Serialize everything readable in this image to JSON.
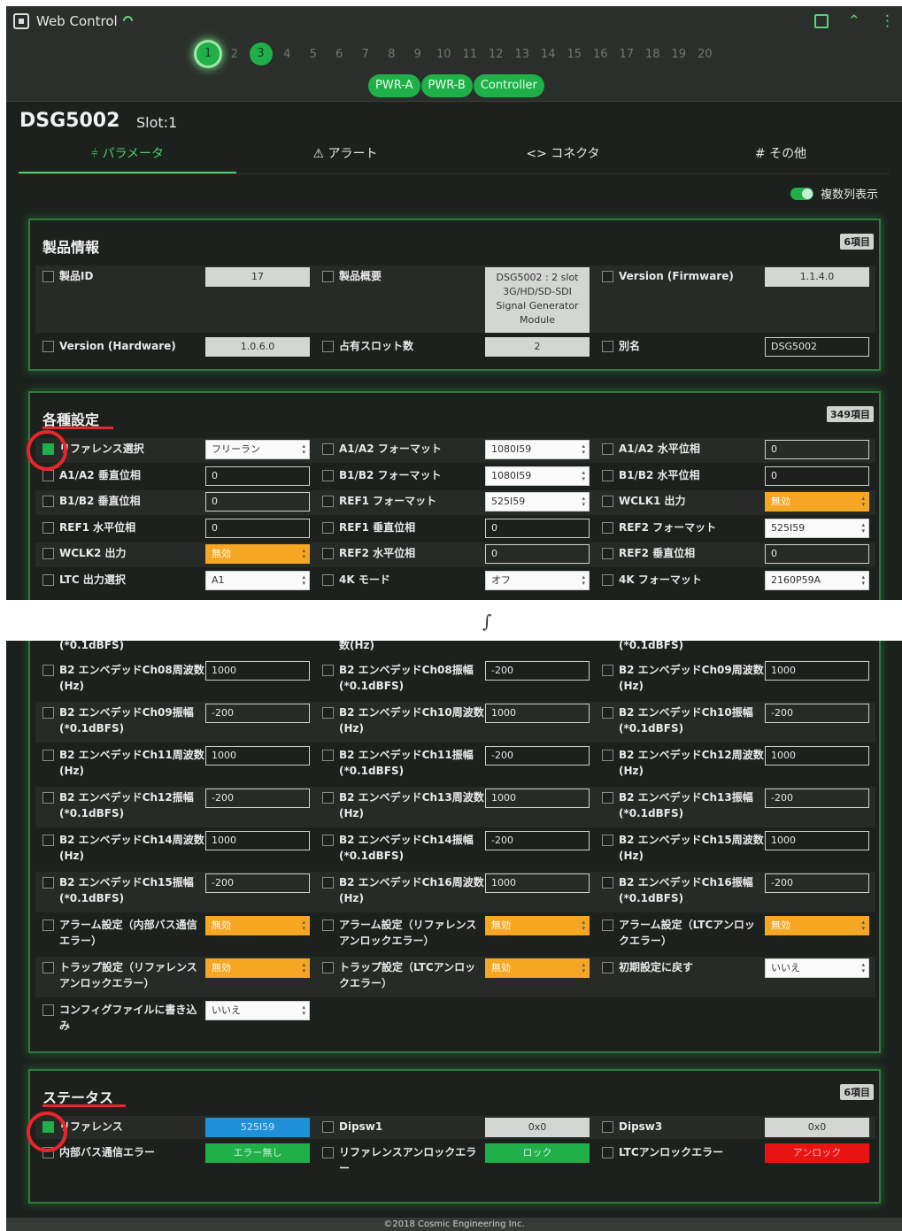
{
  "app": {
    "title": "Web Control"
  },
  "slots": [
    "1",
    "2",
    "3",
    "4",
    "5",
    "6",
    "7",
    "8",
    "9",
    "10",
    "11",
    "12",
    "13",
    "14",
    "15",
    "16",
    "17",
    "18",
    "19",
    "20"
  ],
  "modules": [
    "PWR-A",
    "PWR-B",
    "Controller"
  ],
  "device": {
    "name": "DSG5002",
    "slot": "Slot:1"
  },
  "tabs": [
    "パラメータ",
    "アラート",
    "<> コネクタ",
    "# その他"
  ],
  "multi_column": "複数列表示",
  "product_info": {
    "title": "製品情報",
    "count": "6項目",
    "rows": [
      [
        {
          "label": "製品ID",
          "value": "17",
          "kind": "ro"
        },
        {
          "label": "製品概要",
          "value": "DSG5002 : 2 slot 3G/HD/SD-SDI Signal Generator Module",
          "kind": "ro"
        },
        {
          "label": "Version (Firmware)",
          "value": "1.1.4.0",
          "kind": "ro"
        }
      ],
      [
        {
          "label": "Version (Hardware)",
          "value": "1.0.6.0",
          "kind": "ro"
        },
        {
          "label": "占有スロット数",
          "value": "2",
          "kind": "ro"
        },
        {
          "label": "別名",
          "value": "DSG5002",
          "kind": "in"
        }
      ]
    ]
  },
  "settings": {
    "title": "各種設定",
    "count": "349項目",
    "rows": [
      [
        {
          "label": "リファレンス選択",
          "value": "フリーラン",
          "kind": "sel",
          "checked": true
        },
        {
          "label": "A1/A2 フォーマット",
          "value": "1080I59",
          "kind": "sel"
        },
        {
          "label": "A1/A2 水平位相",
          "value": "0",
          "kind": "in"
        }
      ],
      [
        {
          "label": "A1/A2 垂直位相",
          "value": "0",
          "kind": "in"
        },
        {
          "label": "B1/B2 フォーマット",
          "value": "1080I59",
          "kind": "sel"
        },
        {
          "label": "B1/B2 水平位相",
          "value": "0",
          "kind": "in"
        }
      ],
      [
        {
          "label": "B1/B2 垂直位相",
          "value": "0",
          "kind": "in"
        },
        {
          "label": "REF1 フォーマット",
          "value": "525I59",
          "kind": "sel"
        },
        {
          "label": "WCLK1 出力",
          "value": "無効",
          "kind": "orange"
        }
      ],
      [
        {
          "label": "REF1 水平位相",
          "value": "0",
          "kind": "in"
        },
        {
          "label": "REF1 垂直位相",
          "value": "0",
          "kind": "in"
        },
        {
          "label": "REF2 フォーマット",
          "value": "525I59",
          "kind": "sel"
        }
      ],
      [
        {
          "label": "WCLK2 出力",
          "value": "無効",
          "kind": "orange"
        },
        {
          "label": "REF2 水平位相",
          "value": "0",
          "kind": "in"
        },
        {
          "label": "REF2 垂直位相",
          "value": "0",
          "kind": "in"
        }
      ],
      [
        {
          "label": "LTC 出力選択",
          "value": "A1",
          "kind": "sel"
        },
        {
          "label": "4K モード",
          "value": "オフ",
          "kind": "sel"
        },
        {
          "label": "4K フォーマット",
          "value": "2160P59A",
          "kind": "sel"
        }
      ]
    ],
    "partial_labels": [
      "(*0.1dBFS)",
      "数(Hz)",
      "(*0.1dBFS)"
    ],
    "rows_bottom": [
      [
        {
          "label": "B2 エンベデッドCh08周波数(Hz)",
          "value": "1000",
          "kind": "in"
        },
        {
          "label": "B2 エンベデッドCh08振幅(*0.1dBFS)",
          "value": "-200",
          "kind": "in"
        },
        {
          "label": "B2 エンベデッドCh09周波数(Hz)",
          "value": "1000",
          "kind": "in"
        }
      ],
      [
        {
          "label": "B2 エンベデッドCh09振幅(*0.1dBFS)",
          "value": "-200",
          "kind": "in"
        },
        {
          "label": "B2 エンベデッドCh10周波数(Hz)",
          "value": "1000",
          "kind": "in"
        },
        {
          "label": "B2 エンベデッドCh10振幅(*0.1dBFS)",
          "value": "-200",
          "kind": "in"
        }
      ],
      [
        {
          "label": "B2 エンベデッドCh11周波数(Hz)",
          "value": "1000",
          "kind": "in"
        },
        {
          "label": "B2 エンベデッドCh11振幅(*0.1dBFS)",
          "value": "-200",
          "kind": "in"
        },
        {
          "label": "B2 エンベデッドCh12周波数(Hz)",
          "value": "1000",
          "kind": "in"
        }
      ],
      [
        {
          "label": "B2 エンベデッドCh12振幅(*0.1dBFS)",
          "value": "-200",
          "kind": "in"
        },
        {
          "label": "B2 エンベデッドCh13周波数(Hz)",
          "value": "1000",
          "kind": "in"
        },
        {
          "label": "B2 エンベデッドCh13振幅(*0.1dBFS)",
          "value": "-200",
          "kind": "in"
        }
      ],
      [
        {
          "label": "B2 エンベデッドCh14周波数(Hz)",
          "value": "1000",
          "kind": "in"
        },
        {
          "label": "B2 エンベデッドCh14振幅(*0.1dBFS)",
          "value": "-200",
          "kind": "in"
        },
        {
          "label": "B2 エンベデッドCh15周波数(Hz)",
          "value": "1000",
          "kind": "in"
        }
      ],
      [
        {
          "label": "B2 エンベデッドCh15振幅(*0.1dBFS)",
          "value": "-200",
          "kind": "in"
        },
        {
          "label": "B2 エンベデッドCh16周波数(Hz)",
          "value": "1000",
          "kind": "in"
        },
        {
          "label": "B2 エンベデッドCh16振幅(*0.1dBFS)",
          "value": "-200",
          "kind": "in"
        }
      ],
      [
        {
          "label": "アラーム設定（内部バス通信エラー）",
          "value": "無効",
          "kind": "orange"
        },
        {
          "label": "アラーム設定（リファレンスアンロックエラー）",
          "value": "無効",
          "kind": "orange"
        },
        {
          "label": "アラーム設定（LTCアンロックエラー）",
          "value": "無効",
          "kind": "orange"
        }
      ],
      [
        {
          "label": "トラップ設定（リファレンスアンロックエラー）",
          "value": "無効",
          "kind": "orange"
        },
        {
          "label": "トラップ設定（LTCアンロックエラー）",
          "value": "無効",
          "kind": "orange"
        },
        {
          "label": "初期設定に戻す",
          "value": "いいえ",
          "kind": "sel"
        }
      ],
      [
        {
          "label": "コンフィグファイルに書き込み",
          "value": "いいえ",
          "kind": "sel"
        }
      ]
    ]
  },
  "status": {
    "title": "ステータス",
    "count": "6項目",
    "rows": [
      [
        {
          "label": "リファレンス",
          "value": "525I59",
          "kind": "blue",
          "checked": true
        },
        {
          "label": "Dipsw1",
          "value": "0x0",
          "kind": "ro"
        },
        {
          "label": "Dipsw3",
          "value": "0x0",
          "kind": "ro"
        }
      ],
      [
        {
          "label": "内部バス通信エラー",
          "value": "エラー無し",
          "kind": "green"
        },
        {
          "label": "リファレンスアンロックエラー",
          "value": "ロック",
          "kind": "green"
        },
        {
          "label": "LTCアンロックエラー",
          "value": "アンロック",
          "kind": "red"
        }
      ]
    ]
  },
  "footer": "©2018 Cosmic Engineering Inc."
}
